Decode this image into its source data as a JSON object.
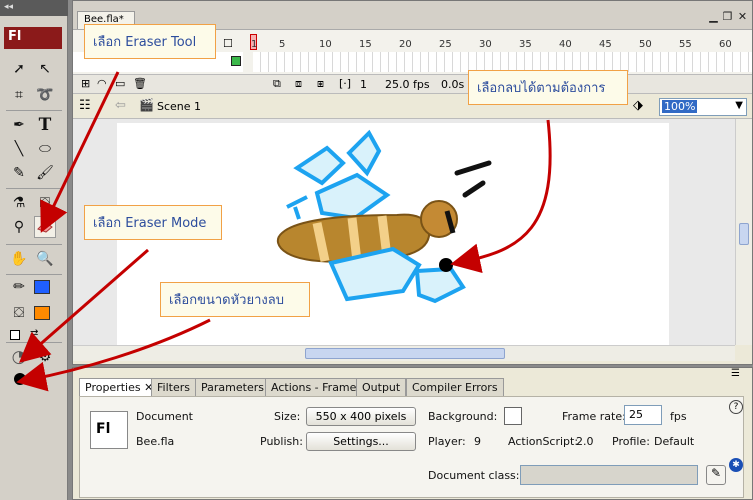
{
  "toolbar": {
    "logo": "Fl",
    "grip": "◂◂"
  },
  "document": {
    "tab_title": "Bee.fla*",
    "frame_numbers": [
      "1",
      "5",
      "10",
      "15",
      "20",
      "25",
      "30",
      "35",
      "40",
      "45",
      "50",
      "55",
      "60"
    ],
    "current_frame": "1",
    "fps": "25.0 fps",
    "elapsed": "0.0s",
    "scene_name": "Scene 1",
    "zoom": "100%"
  },
  "callouts": {
    "eraser_tool": "เลือก Eraser Tool",
    "erase_as_needed": "เลือกลบได้ตามต้องการ",
    "eraser_mode": "เลือก Eraser Mode",
    "eraser_size": "เลือกขนาดหัวยางลบ"
  },
  "properties": {
    "tabs": [
      "Properties",
      "Filters",
      "Parameters",
      "Actions - Frame",
      "Output",
      "Compiler Errors"
    ],
    "doc_type_label": "Document",
    "doc_name": "Bee.fla",
    "doc_icon": "Fl",
    "size_label": "Size:",
    "size_value": "550 x 400 pixels",
    "publish_label": "Publish:",
    "settings_button": "Settings...",
    "background_label": "Background:",
    "frame_rate_label": "Frame rate:",
    "frame_rate_value": "25",
    "fps_unit": "fps",
    "player_label": "Player:",
    "player_value": "9",
    "actionscript_label": "ActionScript:",
    "actionscript_value": "2.0",
    "profile_label": "Profile:",
    "profile_value": "Default",
    "document_class_label": "Document class:",
    "document_class_value": ""
  },
  "colors": {
    "stroke_color": "#000000",
    "fill_color_top": "#1f5fff",
    "fill_color_bottom": "#ff8a00",
    "callout_border": "#f1a146",
    "callout_text": "#2d4d9d",
    "arrow": "#c40000"
  }
}
